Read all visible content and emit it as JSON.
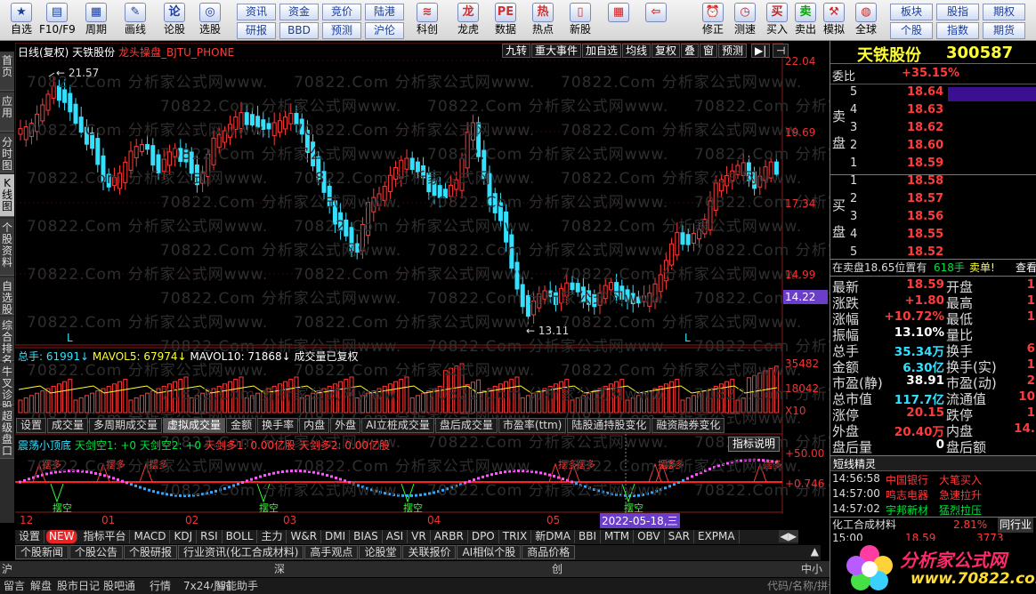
{
  "toolbar": {
    "main": [
      {
        "label": "自选",
        "icon": "star-icon"
      },
      {
        "label": "F10/F9",
        "icon": "f10-icon"
      },
      {
        "label": "周期",
        "icon": "calendar-icon"
      },
      {
        "label": "画线",
        "icon": "pen-icon"
      },
      {
        "label": "论股",
        "icon": "forum-icon"
      },
      {
        "label": "选股",
        "icon": "stock-select-icon"
      }
    ],
    "small": [
      [
        "资讯",
        "研报"
      ],
      [
        "资金",
        "BBD"
      ],
      [
        "竞价",
        "预测"
      ],
      [
        "陆港",
        "沪伦"
      ]
    ],
    "apps": [
      {
        "label": "科创",
        "icon": "chart-icon"
      },
      {
        "label": "龙虎",
        "icon": "dragon-icon"
      },
      {
        "label": "数据",
        "icon": "pe-icon"
      },
      {
        "label": "热点",
        "icon": "hot-icon"
      },
      {
        "label": "新股",
        "icon": "new-stock-icon"
      }
    ],
    "actions": [
      {
        "label": "",
        "icon": "grid-icon"
      },
      {
        "label": "",
        "icon": "back-arrow-icon"
      },
      {
        "label": "修正",
        "icon": "alarm-clock-icon"
      },
      {
        "label": "测速",
        "icon": "speed-icon"
      },
      {
        "label": "买入",
        "icon": "buy-icon"
      },
      {
        "label": "卖出",
        "icon": "sell-icon"
      },
      {
        "label": "模拟",
        "icon": "hammer-icon"
      },
      {
        "label": "全球",
        "icon": "globe-icon"
      }
    ],
    "right_small": [
      [
        "板块",
        "个股"
      ],
      [
        "股指",
        "指数"
      ],
      [
        "期权",
        "期货"
      ]
    ]
  },
  "left_tabs": [
    "首页",
    "应用",
    "分时图",
    "K线图",
    "个股资料",
    "自选股",
    "综合排名",
    "牛叉诊股",
    "超级盘口"
  ],
  "chart": {
    "info": "日线(复权) 天铁股份",
    "formula": "龙头操盘_BJTU_PHONE",
    "top_tabs": [
      "九转",
      "重大事件",
      "加自选",
      "均线",
      "复权",
      "叠",
      "窗",
      "预测"
    ],
    "price_labels": [
      "22.04",
      "19.69",
      "17.34",
      "14.99"
    ],
    "current_price": "14.22",
    "high_label": "21.57",
    "low_label": "13.11",
    "l_marks": [
      "L",
      "L"
    ],
    "watermark": "70822.Com 分析家公式网www.",
    "vol_info": [
      {
        "t": "总手: 61991↓",
        "c": "#33e0ff"
      },
      {
        "t": "MAVOL5: 67974↓",
        "c": "#ffff33"
      },
      {
        "t": "MAVOL10: 71868↓",
        "c": "#ffffff"
      },
      {
        "t": "成交量已复权",
        "c": "#ffffff"
      }
    ],
    "vol_labels": [
      "35482",
      "18042",
      "X10"
    ],
    "sub_tabs": [
      "设置",
      "成交量",
      "多周期成交量",
      "虚拟成交量",
      "金额",
      "换手率",
      "内盘",
      "外盘",
      "AI立桩成交量",
      "盘后成交量",
      "市盈率(ttm)",
      "陆股通持股变化",
      "融资融券变化"
    ],
    "ind_button": "指标说明",
    "ind_info": [
      {
        "t": "震荡小顶底",
        "c": "#33e0ff"
      },
      {
        "t": "天剑空1: +0",
        "c": "#00e23c"
      },
      {
        "t": "天剑空2: +0",
        "c": "#00e23c"
      },
      {
        "t": "天剑多1: 0.00亿股",
        "c": "#ff3b3b"
      },
      {
        "t": "天剑多2: 0.00亿股",
        "c": "#ff3b3b"
      }
    ],
    "ind_labels": [
      "+50.00",
      "+0.746"
    ],
    "ind_markers": {
      "up": "摆多",
      "down": "摆空"
    },
    "dates": [
      "12",
      "01",
      "02",
      "03",
      "04",
      "05"
    ],
    "date_highlight": "2022-05-18,三",
    "ind_tabs": [
      "设置",
      "NEW",
      "指标平台",
      "MACD",
      "KDJ",
      "RSI",
      "BOLL",
      "主力",
      "W&R",
      "DMI",
      "BIAS",
      "ASI",
      "VR",
      "ARBR",
      "DPO",
      "TRIX",
      "新DMA",
      "BBI",
      "MTM",
      "OBV",
      "SAR",
      "EXPMA"
    ],
    "news_tabs": [
      "个股新闻",
      "个股公告",
      "个股研报",
      "行业资讯(化工合成材料)",
      "高手观点",
      "论股堂",
      "关联报价",
      "AI相似个股",
      "商品价格"
    ]
  },
  "status": {
    "row1": [
      "沪",
      "深",
      "创",
      "中小"
    ],
    "row2": [
      "留言",
      "解盘",
      "股市日记",
      "股吧通",
      "行情",
      "7x24小时",
      "智能助手",
      "代码/名称/拼音"
    ]
  },
  "quote": {
    "name": "天铁股份",
    "code": "300587",
    "wb_label": "委比",
    "wb_value": "+35.15%",
    "sell_label": "卖盘",
    "buy_label": "买盘",
    "asks": [
      {
        "n": "5",
        "p": "18.64"
      },
      {
        "n": "4",
        "p": "18.63"
      },
      {
        "n": "3",
        "p": "18.62"
      },
      {
        "n": "2",
        "p": "18.60"
      },
      {
        "n": "1",
        "p": "18.59"
      }
    ],
    "bids": [
      {
        "n": "1",
        "p": "18.58"
      },
      {
        "n": "2",
        "p": "18.57"
      },
      {
        "n": "3",
        "p": "18.56"
      },
      {
        "n": "4",
        "p": "18.55"
      },
      {
        "n": "5",
        "p": "18.52"
      }
    ],
    "note_a": "在卖盘18.65位置有",
    "note_b": "618手",
    "note_c": "卖单!",
    "note_d": "查看",
    "fields": [
      {
        "l": "最新",
        "v": "18.59",
        "vc": "red",
        "l2": "开盘",
        "v2": "1"
      },
      {
        "l": "涨跌",
        "v": "+1.80",
        "vc": "red",
        "l2": "最高",
        "v2": "1"
      },
      {
        "l": "涨幅",
        "v": "+10.72%",
        "vc": "red",
        "l2": "最低",
        "v2": "1"
      },
      {
        "l": "振幅",
        "v": "13.10%",
        "vc": "wht",
        "l2": "量比",
        "v2": ""
      },
      {
        "l": "总手",
        "v": "35.34万",
        "vc": "cyan",
        "l2": "换手",
        "v2": "6"
      },
      {
        "l": "金额",
        "v": "6.30亿",
        "vc": "cyan",
        "l2": "换手(实)",
        "v2": "1"
      },
      {
        "l": "市盈(静)",
        "v": "38.91",
        "vc": "wht",
        "l2": "市盈(动)",
        "v2": "2"
      },
      {
        "l": "总市值",
        "v": "117.7亿",
        "vc": "cyan",
        "l2": "流通值",
        "v2": "10"
      },
      {
        "l": "涨停",
        "v": "20.15",
        "vc": "red",
        "l2": "跌停",
        "v2": "1"
      },
      {
        "l": "外盘",
        "v": "20.40万",
        "vc": "red",
        "l2": "内盘",
        "v2": "14."
      },
      {
        "l": "盘后量",
        "v": "0",
        "vc": "wht",
        "l2": "盘后额",
        "v2": ""
      }
    ],
    "sprite_title": "短线精灵",
    "sprite": [
      {
        "t": "14:56:58",
        "n": "中国银行",
        "e": "大笔买入",
        "c": "red"
      },
      {
        "t": "14:57:00",
        "n": "鸣志电器",
        "e": "急速拉升",
        "c": "red"
      },
      {
        "t": "14:57:02",
        "n": "宇邦新材",
        "e": "猛烈拉压",
        "c": "grn"
      }
    ],
    "industry": "化工合成材料",
    "industry_pct": "2.81%",
    "industry_btn": "同行业",
    "trade": {
      "t": "15:00",
      "p": "18.59",
      "v": "3773"
    }
  },
  "logo": {
    "text": "分析家公式网",
    "url": "www.70822.com"
  },
  "colors": {
    "up": "#ff3b3b",
    "down": "#33e0ff",
    "accent": "#ffff33",
    "brand": "#ff2a6a"
  }
}
